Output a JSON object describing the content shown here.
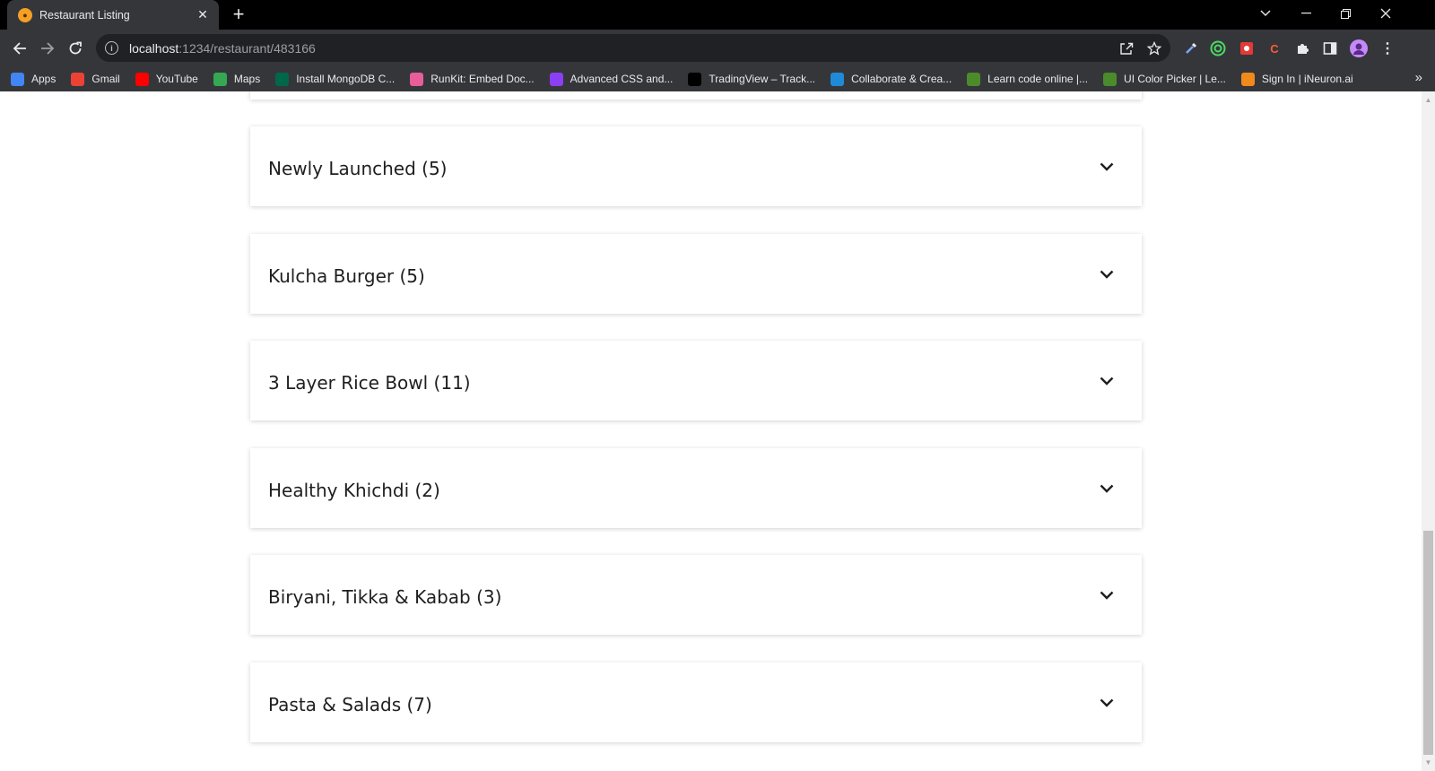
{
  "browser": {
    "tab_title": "Restaurant Listing",
    "url_host": "localhost",
    "url_path": ":1234/restaurant/483166",
    "bookmarks": [
      {
        "label": "Apps",
        "icon": "apps-grid-icon",
        "color": "#4285f4"
      },
      {
        "label": "Gmail",
        "icon": "gmail-icon",
        "color": "#ea4335"
      },
      {
        "label": "YouTube",
        "icon": "youtube-icon",
        "color": "#ff0000"
      },
      {
        "label": "Maps",
        "icon": "maps-pin-icon",
        "color": "#34a853"
      },
      {
        "label": "Install MongoDB C...",
        "icon": "mongodb-leaf-icon",
        "color": "#00684a"
      },
      {
        "label": "RunKit: Embed Doc...",
        "icon": "runkit-icon",
        "color": "#e85d9a"
      },
      {
        "label": "Advanced CSS and...",
        "icon": "udemy-icon",
        "color": "#8b3ff2"
      },
      {
        "label": "TradingView – Track...",
        "icon": "tradingview-icon",
        "color": "#000000"
      },
      {
        "label": "Collaborate & Crea...",
        "icon": "canva-icon",
        "color": "#1f8bd8"
      },
      {
        "label": "Learn code online |...",
        "icon": "codeacademy-icon",
        "color": "#4c8b2b"
      },
      {
        "label": "UI Color Picker | Le...",
        "icon": "colorpicker-icon",
        "color": "#4c8b2b"
      },
      {
        "label": "Sign In | iNeuron.ai",
        "icon": "ineuron-icon",
        "color": "#f08a1c"
      }
    ]
  },
  "menu": {
    "categories": [
      {
        "label": "Newly Launched (5)"
      },
      {
        "label": "Kulcha Burger (5)"
      },
      {
        "label": "3 Layer Rice Bowl (11)"
      },
      {
        "label": "Healthy Khichdi (2)"
      },
      {
        "label": "Biryani, Tikka & Kabab (3)"
      },
      {
        "label": "Pasta & Salads (7)"
      }
    ]
  }
}
